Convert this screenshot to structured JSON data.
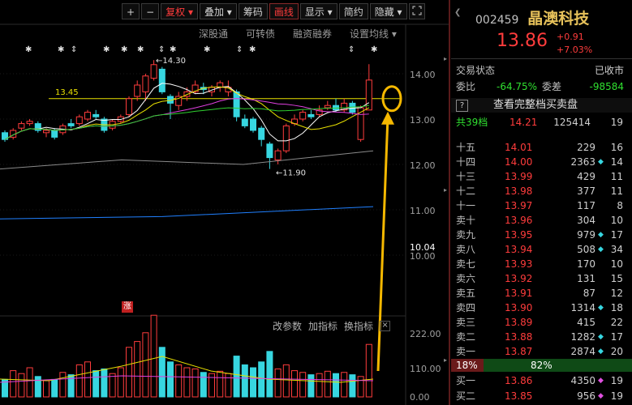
{
  "toolbar": {
    "buttons": [
      "+",
      "−",
      "复权 ▾",
      "叠加 ▾",
      "筹码",
      "画线",
      "显示 ▾",
      "简约",
      "隐藏 ▾"
    ],
    "expand_icon": "expand-icon"
  },
  "submenu": [
    "深股通",
    "可转债",
    "融资融券",
    "设置均线 ▾"
  ],
  "chart": {
    "y_labels": [
      "14.00",
      "13.00",
      "12.00",
      "11.00",
      "10.04",
      "10.00"
    ],
    "vol_labels": [
      "222.00",
      "110.00",
      "0.00"
    ],
    "hline_label": "13.45",
    "high_label": "14.30",
    "low_label": "11.90",
    "limit_badge": "涨",
    "indicator_links": [
      "改参数",
      "加指标",
      "换指标"
    ],
    "close_icon": "close-icon",
    "colors": {
      "up": "#ff3c3c",
      "down": "#37d6e0",
      "ma5": "#ffffff",
      "ma10": "#e8e000",
      "ma20": "#e040e0",
      "ma30": "#30d030",
      "ma60": "#8a8a8a",
      "ma120": "#2080ff",
      "annotation": "#f5b800"
    }
  },
  "quote": {
    "code": "002459",
    "name": "晶澳科技",
    "price": "13.86",
    "change": "+0.91",
    "change_pct": "+7.03%",
    "trade_status_label": "交易状态",
    "trade_status": "已收市",
    "webi_label": "委比",
    "webi": "-64.75%",
    "weicha_label": "委差",
    "weicha": "-98584",
    "full_book_label": "查看完整档买卖盘",
    "help_icon": "?",
    "total_levels": "共39档",
    "total_price": "14.21",
    "total_vol": "125414",
    "total_count": "19",
    "asks": [
      {
        "label": "十五",
        "price": "14.01",
        "vol": "229",
        "arrow": "",
        "count": "16"
      },
      {
        "label": "十四",
        "price": "14.00",
        "vol": "2363",
        "arrow": "◆",
        "count": "14"
      },
      {
        "label": "十三",
        "price": "13.99",
        "vol": "429",
        "arrow": "",
        "count": "11"
      },
      {
        "label": "十二",
        "price": "13.98",
        "vol": "377",
        "arrow": "",
        "count": "11"
      },
      {
        "label": "十一",
        "price": "13.97",
        "vol": "117",
        "arrow": "",
        "count": "8"
      },
      {
        "label": "卖十",
        "price": "13.96",
        "vol": "304",
        "arrow": "",
        "count": "10"
      },
      {
        "label": "卖九",
        "price": "13.95",
        "vol": "979",
        "arrow": "◆",
        "count": "17"
      },
      {
        "label": "卖八",
        "price": "13.94",
        "vol": "508",
        "arrow": "◆",
        "count": "34"
      },
      {
        "label": "卖七",
        "price": "13.93",
        "vol": "170",
        "arrow": "",
        "count": "10"
      },
      {
        "label": "卖六",
        "price": "13.92",
        "vol": "131",
        "arrow": "",
        "count": "15"
      },
      {
        "label": "卖五",
        "price": "13.91",
        "vol": "87",
        "arrow": "",
        "count": "12"
      },
      {
        "label": "卖四",
        "price": "13.90",
        "vol": "1314",
        "arrow": "◆",
        "count": "18"
      },
      {
        "label": "卖三",
        "price": "13.89",
        "vol": "415",
        "arrow": "",
        "count": "22"
      },
      {
        "label": "卖二",
        "price": "13.88",
        "vol": "1282",
        "arrow": "◆",
        "count": "17"
      },
      {
        "label": "卖一",
        "price": "13.87",
        "vol": "2874",
        "arrow": "◆",
        "count": "20"
      }
    ],
    "ratio_left": "18%",
    "ratio_right": "82%",
    "bids": [
      {
        "label": "买一",
        "price": "13.86",
        "vol": "4350",
        "arrow": "◆",
        "count": "19"
      },
      {
        "label": "买二",
        "price": "13.85",
        "vol": "956",
        "arrow": "◆",
        "count": "19"
      }
    ]
  }
}
